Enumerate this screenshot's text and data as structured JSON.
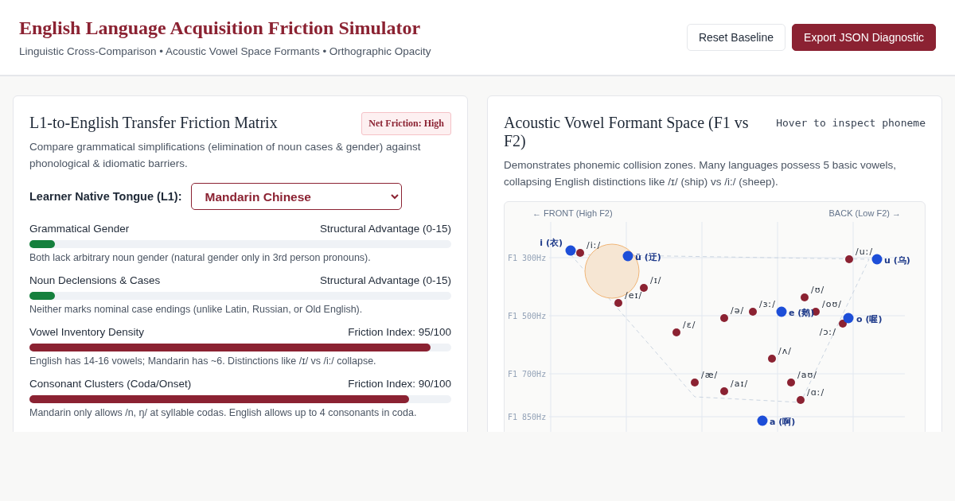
{
  "header": {
    "title": "English Language Acquisition Friction Simulator",
    "subtitle": "Linguistic Cross-Comparison • Acoustic Vowel Space Formants • Orthographic Opacity",
    "buttons": [
      {
        "label": "Reset Baseline",
        "kind": "secondary"
      },
      {
        "label": "Export JSON Diagnostic",
        "kind": "primary"
      }
    ]
  },
  "friction_panel": {
    "title": "L1-to-English Transfer Friction Matrix",
    "badge": "Net Friction: High",
    "description": "Compare grammatical simplifications (elimination of noun cases & gender) against phonological & idiomatic barriers.",
    "select_label": "Learner Native Tongue (L1):",
    "select_value": "Mandarin Chinese",
    "metrics": [
      {
        "name": "Grammatical Gender",
        "kind": "advantage",
        "reading": "Structural Advantage (0-15)",
        "level": 0.06,
        "note": "Both lack arbitrary noun gender (natural gender only in 3rd person pronouns)."
      },
      {
        "name": "Noun Declensions & Cases",
        "kind": "advantage",
        "reading": "Structural Advantage (0-15)",
        "level": 0.06,
        "note": "Neither marks nominal case endings (unlike Latin, Russian, or Old English)."
      },
      {
        "name": "Vowel Inventory Density",
        "kind": "friction",
        "reading": "Friction Index: 95/100",
        "level": 0.95,
        "note": "English has 14-16 vowels; Mandarin has ~6. Distinctions like /ɪ/ vs /i:/ collapse."
      },
      {
        "name": "Consonant Clusters (Coda/Onset)",
        "kind": "friction",
        "reading": "Friction Index: 90/100",
        "level": 0.9,
        "note": "Mandarin only allows /n, ŋ/ at syllable codas. English allows up to 4 consonants in coda."
      }
    ]
  },
  "vowel_panel": {
    "title": "Acoustic Vowel Formant Space (F1 vs F2)",
    "hint": "Hover to inspect phoneme",
    "description": "Demonstrates phonemic collision zones. Many languages possess 5 basic vowels, collapsing English distinctions like /ɪ/ (ship) vs /i:/ (sheep).",
    "plot": {
      "direction_labels": [
        "← FRONT (High F2)",
        "BACK (Low F2) →"
      ],
      "y_labels": [
        "F1 300Hz",
        "F1 500Hz",
        "F1 700Hz",
        "F1 850Hz"
      ],
      "groups": [
        {
          "kind": "english",
          "color": "#8b2232",
          "labels": [
            "/iː/",
            "/ɪ/",
            "/eɪ/",
            "/ɛ/",
            "/æ/",
            "/aɪ/",
            "/ə/",
            "/ɜː/",
            "/ʌ/",
            "/ʊ/",
            "/oʊ/",
            "/aʊ/",
            "/ɑː/",
            "/uː/",
            "/ɔː/"
          ]
        },
        {
          "kind": "mandarin",
          "color": "#1d4ed8",
          "labels": [
            "i (衣)",
            "ü (迂)",
            "u (乌)",
            "e (鹅)",
            "o (喔)",
            "a (啊)"
          ]
        }
      ]
    }
  }
}
